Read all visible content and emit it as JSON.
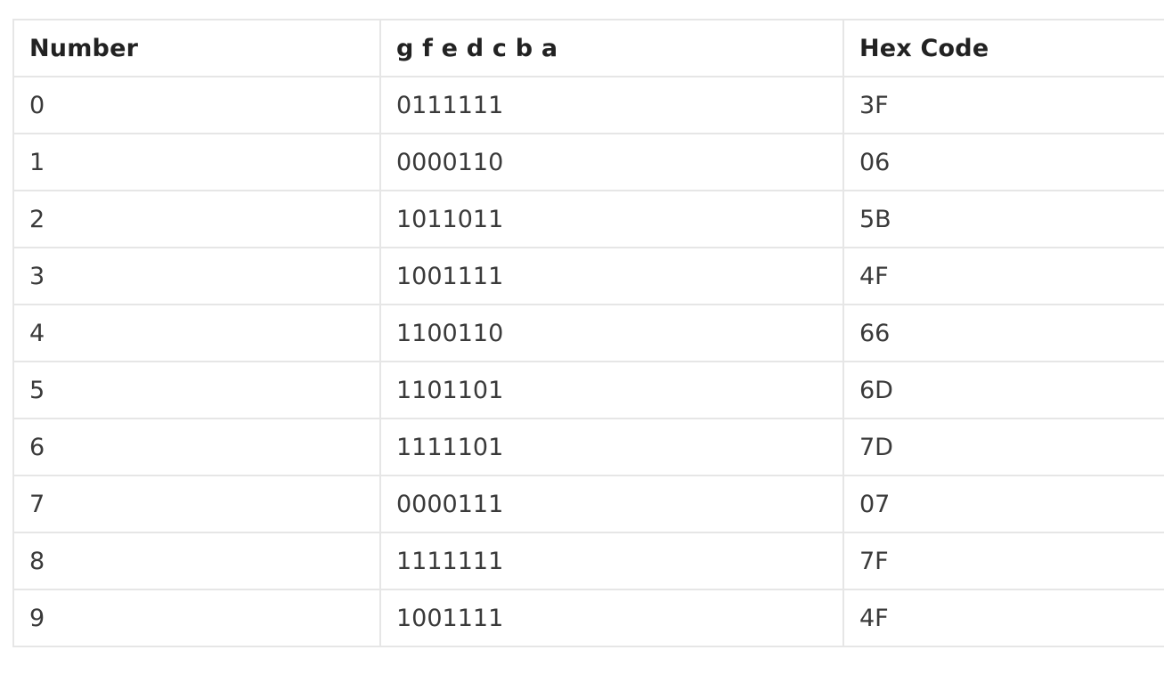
{
  "table": {
    "headers": [
      "Number",
      "g f e d c b a",
      "Hex Code"
    ],
    "rows": [
      [
        "0",
        "0111111",
        "3F"
      ],
      [
        "1",
        "0000110",
        "06"
      ],
      [
        "2",
        "1011011",
        "5B"
      ],
      [
        "3",
        "1001111",
        "4F"
      ],
      [
        "4",
        "1100110",
        "66"
      ],
      [
        "5",
        "1101101",
        "6D"
      ],
      [
        "6",
        "1111101",
        "7D"
      ],
      [
        "7",
        "0000111",
        "07"
      ],
      [
        "8",
        "1111111",
        "7F"
      ],
      [
        "9",
        "1001111",
        "4F"
      ]
    ]
  },
  "colors": {
    "border": "#e6e6e6",
    "header_text": "#222222",
    "cell_text": "#3a3a3a",
    "background": "#ffffff"
  }
}
